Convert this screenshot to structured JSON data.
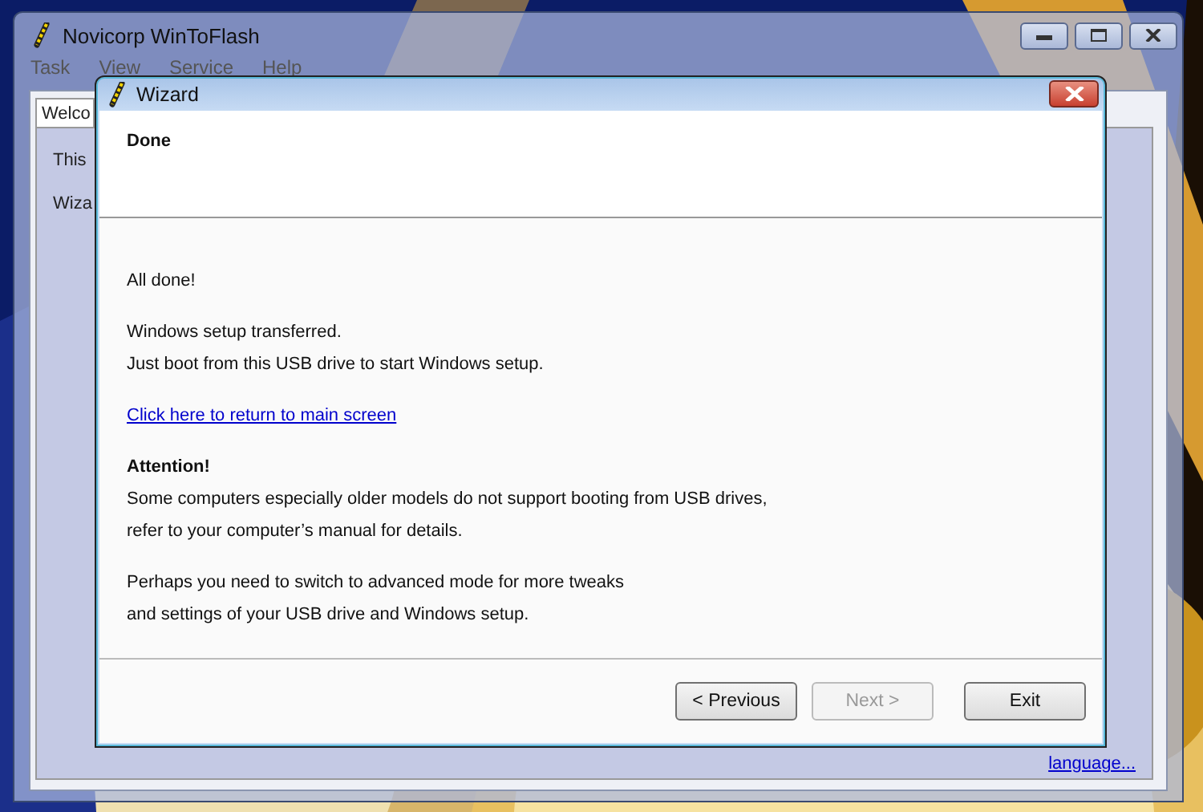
{
  "main_window": {
    "title": "Novicorp WinToFlash",
    "menu": [
      "Task",
      "View",
      "Service",
      "Help"
    ],
    "tabs": [
      {
        "label": "Welco",
        "selected": true
      }
    ],
    "content_lines": [
      "This",
      "Wiza"
    ],
    "language_link": "language..."
  },
  "wizard": {
    "title": "Wizard",
    "heading": "Done",
    "paragraphs": [
      {
        "kind": "text",
        "lines": [
          "All done!"
        ]
      },
      {
        "kind": "text",
        "lines": [
          "Windows setup transferred.",
          "Just boot from this USB drive to start Windows setup."
        ]
      },
      {
        "kind": "link",
        "lines": [
          "Click here to return to main screen"
        ]
      },
      {
        "kind": "notice",
        "title": "Attention!",
        "lines": [
          "Some computers especially older models do not support booting from USB drives,",
          "refer to your computer’s manual for details."
        ]
      },
      {
        "kind": "text",
        "lines": [
          "Perhaps you need to switch to advanced mode for more tweaks",
          "and settings of your USB drive and Windows setup."
        ]
      }
    ],
    "buttons": [
      {
        "label": "< Previous",
        "disabled": false
      },
      {
        "label": "Next >",
        "disabled": true
      },
      {
        "label": "Exit",
        "disabled": false
      }
    ]
  }
}
